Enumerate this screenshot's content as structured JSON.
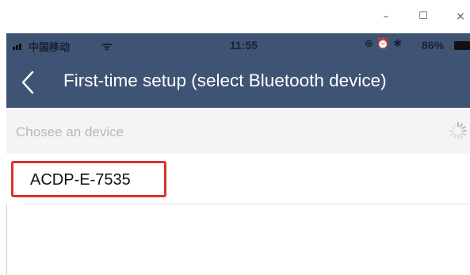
{
  "window": {
    "minimize_glyph": "–",
    "maximize_glyph": "☐",
    "close_glyph": "×"
  },
  "status_bar": {
    "carrier": "中国移动",
    "wifi_glyph": "ᯤ",
    "time": "11:55",
    "icons_text": "⊕ ⏰ ✱",
    "battery_percent": "86%"
  },
  "nav": {
    "title": "First-time setup (select Bluetooth device)"
  },
  "section": {
    "label": "Chosee an device"
  },
  "devices": [
    {
      "name": "ACDP-E-7535",
      "highlighted": true
    }
  ],
  "colors": {
    "header_bg": "#3f5475",
    "highlight": "#d9342b"
  }
}
